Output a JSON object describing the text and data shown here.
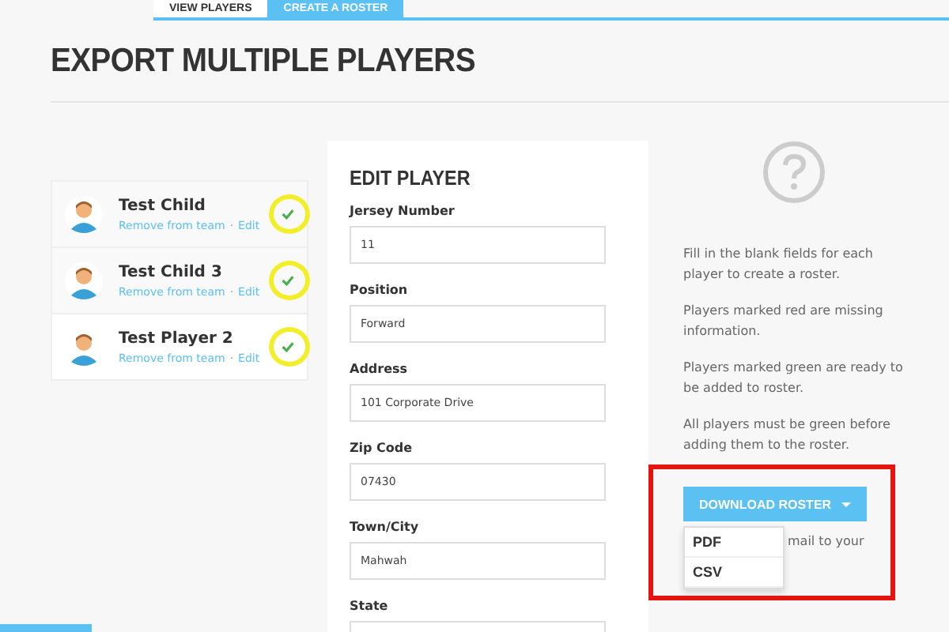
{
  "tabs": [
    {
      "label": "VIEW PLAYERS",
      "selected": false
    },
    {
      "label": "CREATE A ROSTER",
      "selected": true
    }
  ],
  "page_title": "EXPORT MULTIPLE PLAYERS",
  "players": [
    {
      "name": "Test Child",
      "remove_link": "Remove from team",
      "separator": "·",
      "edit_link": "Edit",
      "ready": true,
      "highlighted": true
    },
    {
      "name": "Test Child 3",
      "remove_link": "Remove from team",
      "separator": "·",
      "edit_link": "Edit",
      "ready": true,
      "highlighted": true
    },
    {
      "name": "Test Player 2",
      "remove_link": "Remove from team",
      "separator": "·",
      "edit_link": "Edit",
      "ready": true,
      "highlighted": true
    }
  ],
  "edit_player": {
    "title": "EDIT PLAYER",
    "fields": [
      {
        "label": "Jersey Number",
        "value": "11"
      },
      {
        "label": "Position",
        "value": "Forward"
      },
      {
        "label": "Address",
        "value": "101 Corporate Drive"
      },
      {
        "label": "Zip Code",
        "value": "07430"
      },
      {
        "label": "Town/City",
        "value": "Mahwah"
      },
      {
        "label": "State"
      }
    ]
  },
  "help": {
    "paragraphs": [
      "Fill in the blank fields for each player to create a roster.",
      "Players marked red are missing information.",
      "Players marked green are ready to be added to roster.",
      "All players must be green before adding them to the roster."
    ],
    "download_button": "DOWNLOAD ROSTER",
    "dropdown_open": true,
    "dropdown_options": [
      "PDF",
      "CSV"
    ],
    "partial_text": "mail to your",
    "highlighted": true
  }
}
